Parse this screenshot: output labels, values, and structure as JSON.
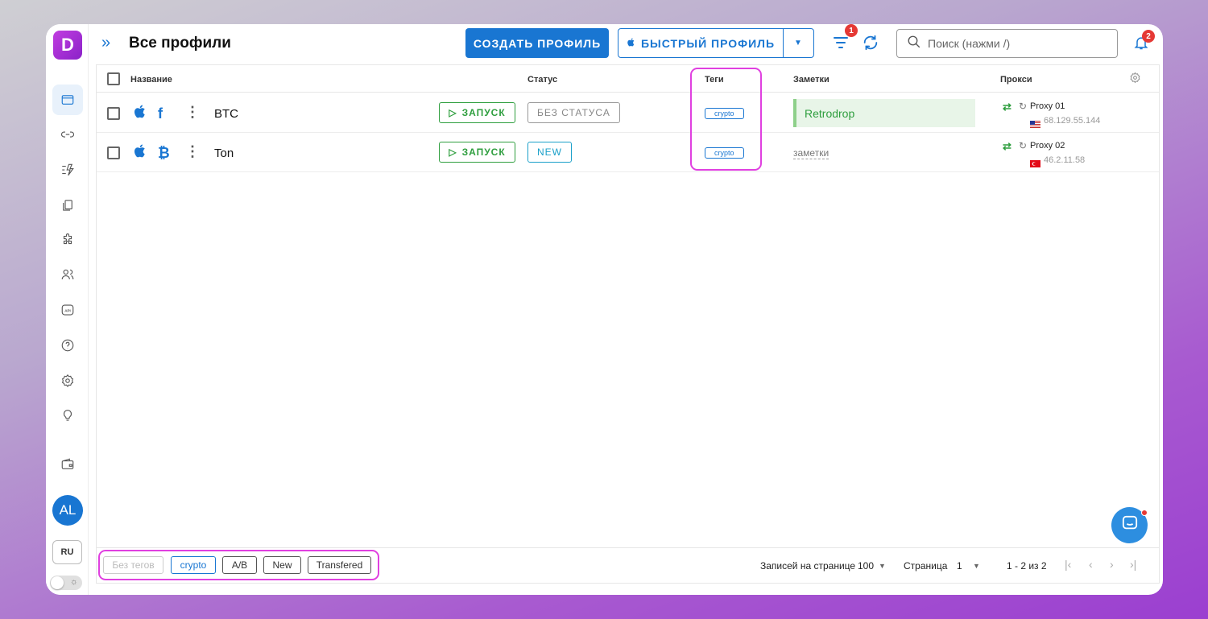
{
  "app": {
    "logo_letter": "D",
    "accent": "#1976d2"
  },
  "header": {
    "title": "Все профили",
    "create_label": "СОЗДАТЬ ПРОФИЛЬ",
    "quick_label": "БЫСТРЫЙ ПРОФИЛЬ",
    "filter_badge": "1",
    "search_placeholder": "Поиск (нажми /)",
    "bell_badge": "2"
  },
  "sidebar": {
    "icons": [
      "browser-icon",
      "link-icon",
      "automation-icon",
      "copy-icon",
      "puzzle-icon",
      "users-icon",
      "api-icon",
      "help-icon",
      "settings-icon",
      "lightbulb-icon",
      "wallet-icon"
    ],
    "avatar": "AL",
    "lang": "RU"
  },
  "table": {
    "columns": {
      "name": "Название",
      "status": "Статус",
      "tags": "Теги",
      "notes": "Заметки",
      "proxy": "Прокси"
    },
    "rows": [
      {
        "name": "BTC",
        "sub_icon": "f",
        "run_label": "ЗАПУСК",
        "status": "БЕЗ СТАТУСА",
        "tag": "crypto",
        "note": "Retrodrop",
        "note_placeholder": "",
        "proxy_name": "Proxy 01",
        "proxy_ip": "68.129.55.144",
        "flag": "us-flag"
      },
      {
        "name": "Ton",
        "sub_icon": "₿",
        "run_label": "ЗАПУСК",
        "status": "NEW",
        "tag": "crypto",
        "note": "",
        "note_placeholder": "заметки",
        "proxy_name": "Proxy 02",
        "proxy_ip": "46.2.11.58",
        "flag": "tr-flag"
      }
    ]
  },
  "footer": {
    "tags": [
      "Без тегов",
      "crypto",
      "A/B",
      "New",
      "Transfered"
    ],
    "per_page_label": "Записей на странице",
    "per_page_value": "100",
    "page_label": "Страница",
    "page_value": "1",
    "range": "1 - 2 из 2"
  }
}
